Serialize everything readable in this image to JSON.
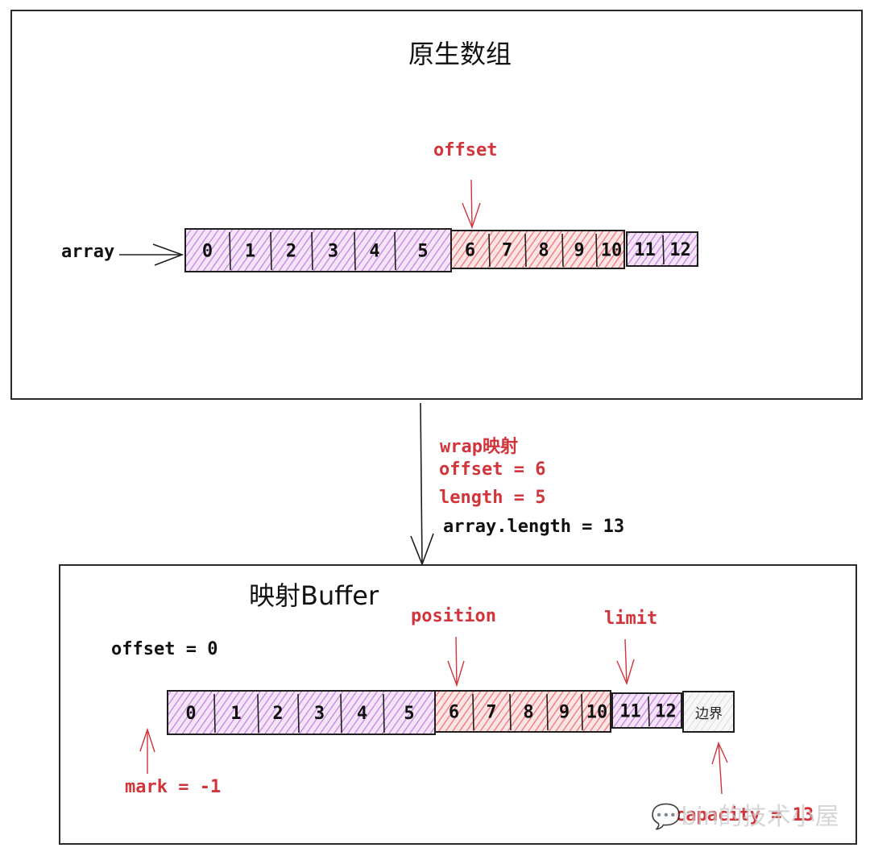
{
  "colors": {
    "purple_fill": "#c77be0",
    "red_fill": "#f26b6b",
    "gray_fill": "#cfcfcf",
    "annotation_red": "#d1343a",
    "stroke": "#1e1e1e"
  },
  "top_panel": {
    "title": "原生数组",
    "array_label": "array",
    "offset_label": "offset",
    "cells": [
      {
        "label": "0",
        "group": "purple"
      },
      {
        "label": "1",
        "group": "purple"
      },
      {
        "label": "2",
        "group": "purple"
      },
      {
        "label": "3",
        "group": "purple"
      },
      {
        "label": "4",
        "group": "purple"
      },
      {
        "label": "5",
        "group": "purple"
      },
      {
        "label": "6",
        "group": "red"
      },
      {
        "label": "7",
        "group": "red"
      },
      {
        "label": "8",
        "group": "red"
      },
      {
        "label": "9",
        "group": "red"
      },
      {
        "label": "10",
        "group": "red"
      },
      {
        "label": "11",
        "group": "purple"
      },
      {
        "label": "12",
        "group": "purple"
      }
    ]
  },
  "transition": {
    "line1": "wrap映射",
    "line2": "offset = 6",
    "line3": "length = 5",
    "line4": "array.length = 13"
  },
  "bottom_panel": {
    "title": "映射Buffer",
    "offset_label": "offset = 0",
    "position_label": "position",
    "limit_label": "limit",
    "mark_label": "mark = -1",
    "capacity_label": "capacity = 13",
    "cells": [
      {
        "label": "0",
        "group": "purple"
      },
      {
        "label": "1",
        "group": "purple"
      },
      {
        "label": "2",
        "group": "purple"
      },
      {
        "label": "3",
        "group": "purple"
      },
      {
        "label": "4",
        "group": "purple"
      },
      {
        "label": "5",
        "group": "purple"
      },
      {
        "label": "6",
        "group": "red"
      },
      {
        "label": "7",
        "group": "red"
      },
      {
        "label": "8",
        "group": "red"
      },
      {
        "label": "9",
        "group": "red"
      },
      {
        "label": "10",
        "group": "red"
      },
      {
        "label": "11",
        "group": "purple"
      },
      {
        "label": "12",
        "group": "purple"
      },
      {
        "label": "边界",
        "group": "gray"
      }
    ]
  },
  "watermark": "bin的技术小屋"
}
